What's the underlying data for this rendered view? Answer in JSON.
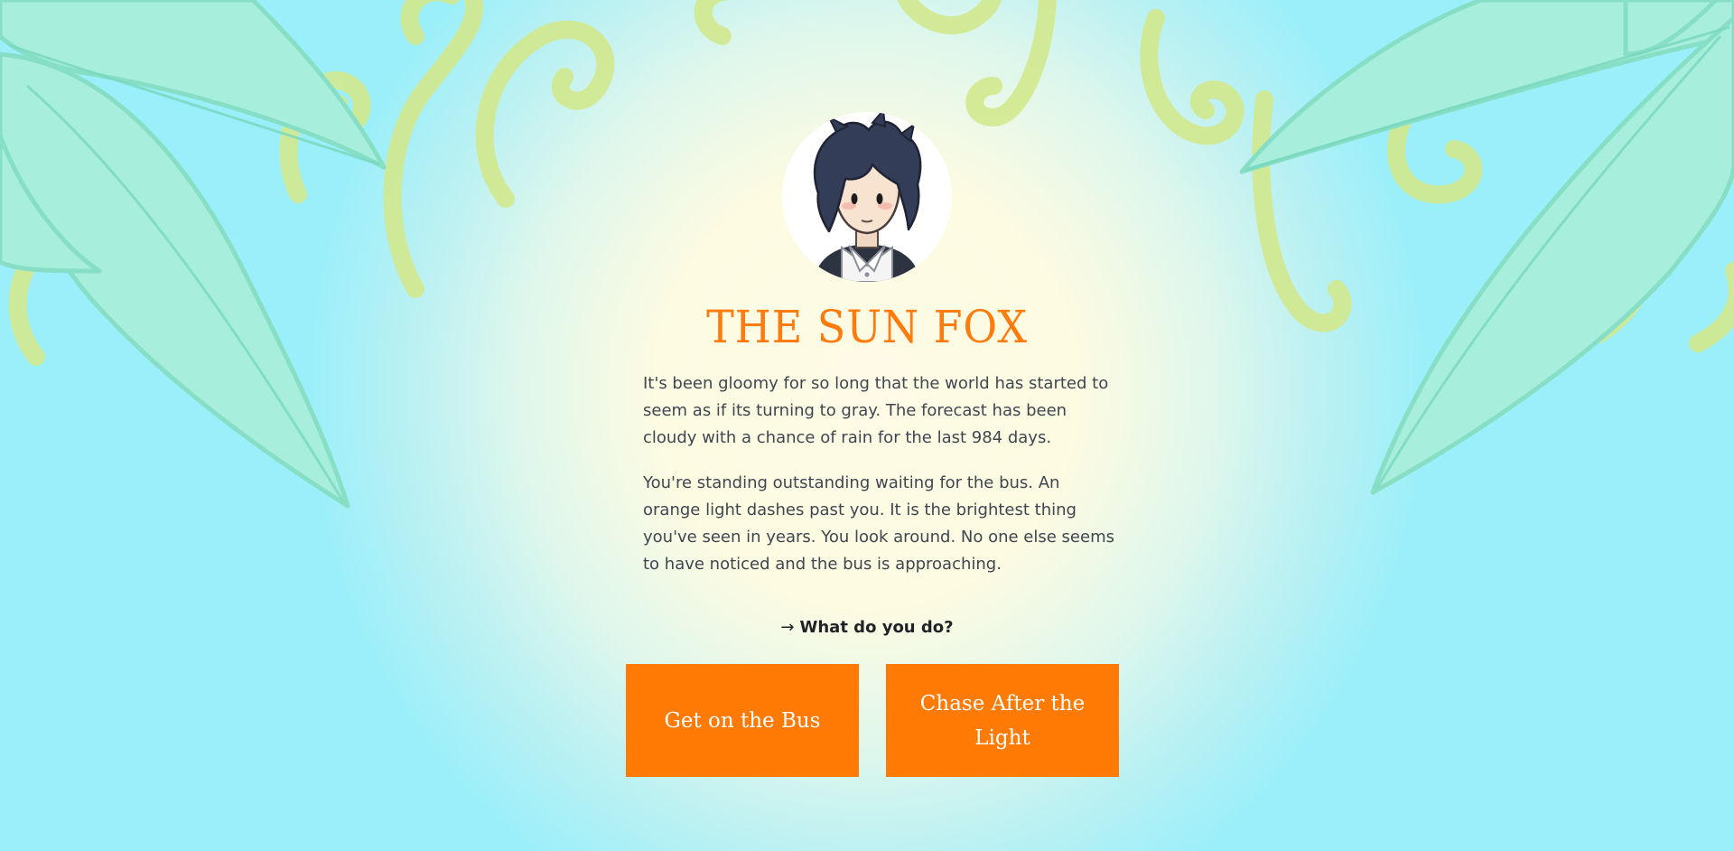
{
  "game": {
    "title": "THE SUN FOX",
    "story": [
      "It's been gloomy for so long that the world has started to seem as if its turning to gray. The forecast has been cloudy with a chance of rain for the last 984 days.",
      "You're standing outstanding waiting for the bus. An orange light dashes past you. It is the brightest thing you've seen in years. You look around. No one else seems to have noticed and the bus is approaching."
    ],
    "prompt_arrow": "→",
    "prompt": "What do you do?",
    "choices": [
      "Get on the Bus",
      "Chase After the Light"
    ]
  },
  "avatar": {
    "icon": "character-portrait-icon"
  },
  "colors": {
    "accent": "#ff7b06",
    "title": "#ff7b0d",
    "body_text": "#3f4650",
    "background_center": "#fffbe6",
    "background_edge": "#9beffa",
    "leaf": "#a6f0df",
    "vine": "#e0f3a8"
  }
}
